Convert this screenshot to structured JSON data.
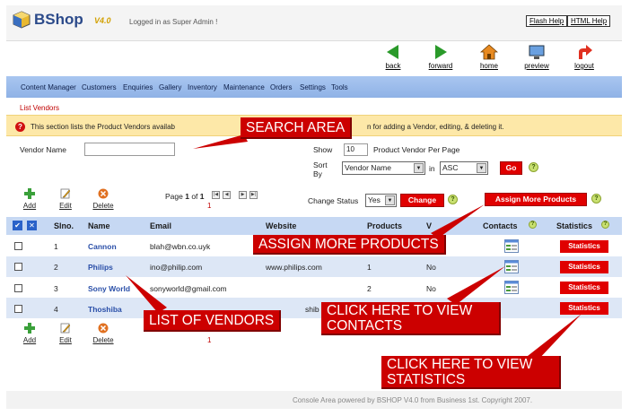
{
  "header": {
    "brand": "BShop",
    "version": "V4.0",
    "logged_in": "Logged in as Super Admin !",
    "flash_help": "Flash Help",
    "html_help": "HTML Help"
  },
  "toolbar": {
    "back": "back",
    "forward": "forward",
    "home": "home",
    "preview": "preview",
    "logout": "logout"
  },
  "menu": [
    "Content Manager",
    "Customers",
    "Enquiries",
    "Gallery",
    "Inventory",
    "Maintenance",
    "Orders",
    "Settings",
    "Tools"
  ],
  "breadcrumb": "List Vendors",
  "info": {
    "text_left": "This section lists the Product Vendors availab",
    "text_right": "n for adding a Vendor, editing, & deleting it."
  },
  "search": {
    "vendor_label": "Vendor Name",
    "vendor_value": "",
    "show_label": "Show",
    "show_value": "10",
    "per_page_label": "Product Vendor Per Page",
    "sort_label_1": "Sort",
    "sort_label_2": "By",
    "sort_field": "Vendor Name",
    "in_label": "in",
    "sort_order": "ASC",
    "go_label": "Go"
  },
  "actions": {
    "add": "Add",
    "edit": "Edit",
    "delete": "Delete",
    "page_prefix": "Page ",
    "page_current": "1",
    "page_of": " of ",
    "page_total": "1",
    "page_link": "1",
    "change_status_label": "Change Status",
    "status_value": "Yes",
    "change_label": "Change",
    "assign_label": "Assign More Products"
  },
  "table": {
    "headers": {
      "slno": "Slno.",
      "name": "Name",
      "email": "Email",
      "website": "Website",
      "products": "Products",
      "v": "V",
      "contacts": "Contacts",
      "statistics": "Statistics"
    },
    "rows": [
      {
        "slno": "1",
        "name": "Cannon",
        "email": "blah@wbn.co.uyk",
        "website": "",
        "products": "",
        "v": "",
        "stat": "Statistics"
      },
      {
        "slno": "2",
        "name": "Philips",
        "email": "ino@philip.com",
        "website": "www.philips.com",
        "products": "1",
        "v": "No",
        "stat": "Statistics"
      },
      {
        "slno": "3",
        "name": "Sony World",
        "email": "sonyworld@gmail.com",
        "website": "",
        "products": "2",
        "v": "No",
        "stat": "Statistics"
      },
      {
        "slno": "4",
        "name": "Thoshiba",
        "email": "",
        "website": "shib",
        "products": "",
        "v": "",
        "stat": "Statistics"
      }
    ]
  },
  "footer": "Console Area powered by BSHOP V4.0 from Business 1st. Copyright 2007.",
  "annotations": {
    "search_area": "SEARCH AREA",
    "assign_more": "ASSIGN MORE PRODUCTS",
    "list_vendors": "LIST OF VENDORS",
    "contacts_1": "CLICK HERE TO VIEW",
    "contacts_2": "CONTACTS",
    "stats_1": "CLICK HERE TO VIEW",
    "stats_2": "STATISTICS"
  },
  "colors": {
    "accent_red": "#e00000",
    "menu_blue": "#a9c6f0",
    "info_yellow": "#fde8a8",
    "table_header": "#c6d8f3",
    "annotation_red": "#cc0000"
  }
}
